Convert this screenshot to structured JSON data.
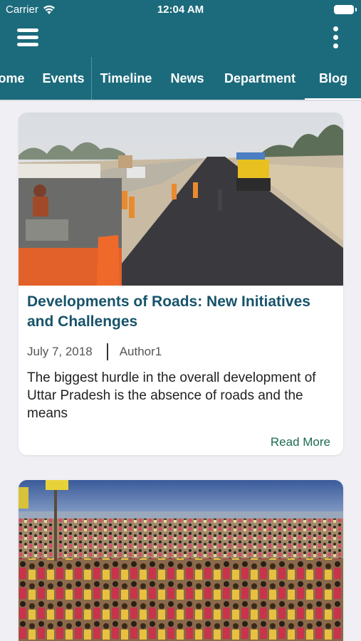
{
  "status_bar": {
    "carrier": "Carrier",
    "time": "12:04 AM",
    "icons": [
      "wifi-icon",
      "battery-icon"
    ]
  },
  "app_bar": {
    "menu_icon": "hamburger-menu-icon",
    "overflow_icon": "more-vertical-icon",
    "background": "#1c6b7c"
  },
  "tabs": [
    {
      "label": "Home",
      "visible_text": "ome",
      "active": false
    },
    {
      "label": "Events",
      "active": false
    },
    {
      "label": "Timeline",
      "active": false
    },
    {
      "label": "News",
      "active": false
    },
    {
      "label": "Department",
      "active": false
    },
    {
      "label": "Blog",
      "active": true
    }
  ],
  "posts": [
    {
      "image": "road-construction-photo",
      "title": "Developments of Roads: New Initiatives and Challenges",
      "date": "July 7, 2018",
      "author": "Author1",
      "excerpt": "The biggest hurdle in the overall development of Uttar Pradesh is the absence of roads and the means",
      "read_more": "Read More"
    },
    {
      "image": "crowd-gathering-photo"
    }
  ],
  "colors": {
    "primary": "#1c6b7c",
    "title": "#17536a",
    "link": "#1c6b50",
    "background": "#efeff4"
  }
}
